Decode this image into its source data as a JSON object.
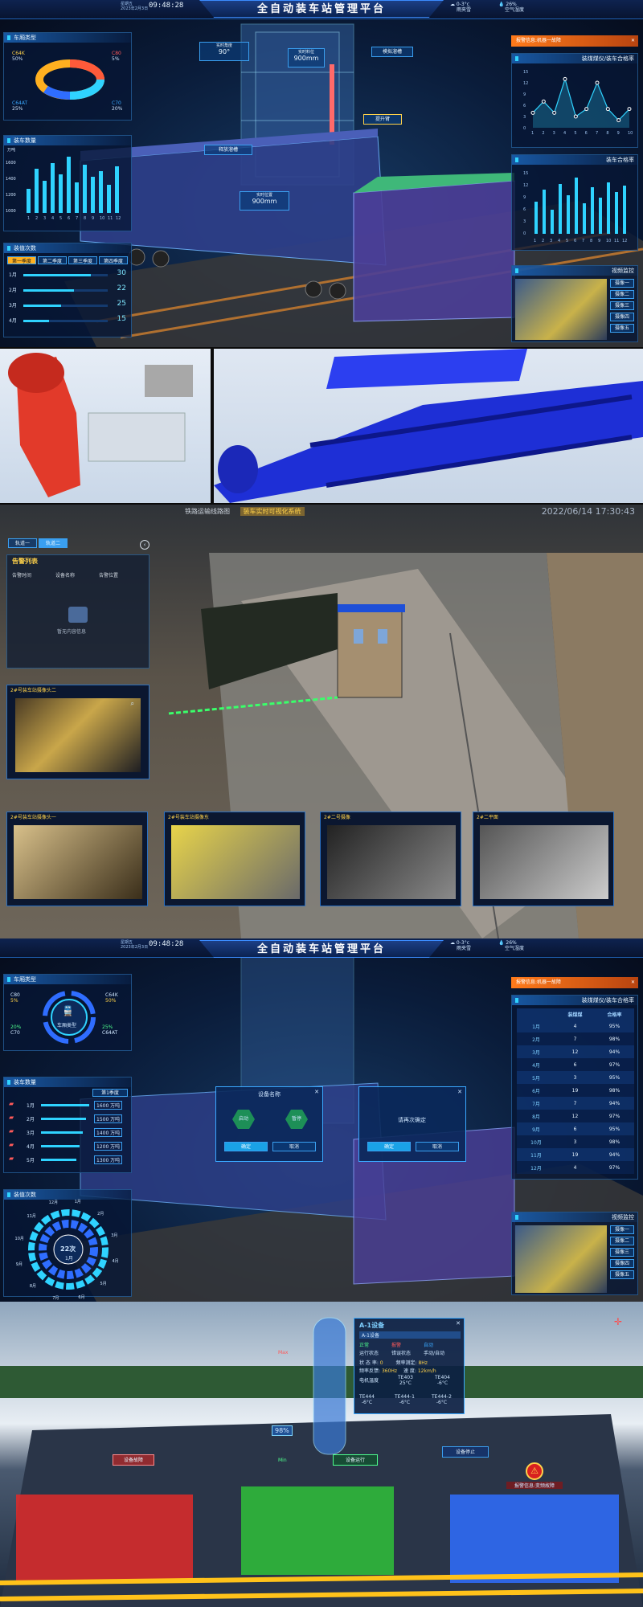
{
  "s1": {
    "title": "全自动装车站管理平台",
    "weekday": "星期五",
    "date": "2023年2月3日",
    "clock": "09:48:28",
    "weather": {
      "temp": "0-3°c",
      "label": "雨夹雪",
      "humidity": "26%",
      "hum_label": "空气湿度"
    },
    "car_types": {
      "title": "车厢类型",
      "items": [
        {
          "name": "C64K",
          "pct": "50%",
          "color": "#ffb020"
        },
        {
          "name": "C80",
          "pct": "5%",
          "color": "#ff5a3a"
        },
        {
          "name": "C64AT",
          "pct": "25%",
          "color": "#2fd3ff"
        },
        {
          "name": "C70",
          "pct": "20%",
          "color": "#2f6dff"
        }
      ]
    },
    "car_count": {
      "title": "装车数量",
      "unit": "万吨",
      "y_ticks": [
        "1600",
        "1400",
        "1200",
        "1000"
      ],
      "x_ticks": [
        "1",
        "2",
        "3",
        "4",
        "5",
        "6",
        "7",
        "8",
        "9",
        "10",
        "11",
        "12"
      ]
    },
    "rank": {
      "title": "装值次数",
      "tabs": [
        "第一季度",
        "第二季度",
        "第三季度",
        "第四季度"
      ],
      "rows": [
        {
          "label": "1月",
          "value": "30",
          "fill": 0.8
        },
        {
          "label": "2月",
          "value": "22",
          "fill": 0.6
        },
        {
          "label": "3月",
          "value": "25",
          "fill": 0.45
        },
        {
          "label": "4月",
          "value": "15",
          "fill": 0.3
        }
      ]
    },
    "tags": [
      {
        "label": "实时角度",
        "value": "90°"
      },
      {
        "label": "实时料位",
        "value": "900mm"
      },
      {
        "label": "实时位置",
        "value": "900mm"
      }
    ],
    "buttons": {
      "open_gate": "模拟溜槽",
      "lift": "提升臂",
      "release": "释放溜槽"
    },
    "alarm": {
      "label": "报警信息:",
      "value": "机器一故障"
    },
    "coal_rate": {
      "title": "装煤煤仪/装车合格率",
      "y_ticks": [
        "15",
        "12",
        "9",
        "6",
        "3",
        "0"
      ],
      "x_ticks": [
        "1",
        "2",
        "3",
        "4",
        "5",
        "6",
        "7",
        "8",
        "9",
        "10"
      ],
      "chart_data": {
        "type": "area",
        "x": [
          1,
          2,
          3,
          4,
          5,
          6,
          7,
          8,
          9,
          10
        ],
        "values": [
          4,
          7,
          4,
          13,
          3,
          5,
          12,
          5,
          2,
          5
        ],
        "ylim": [
          0,
          15
        ]
      }
    },
    "load_rate": {
      "title": "装车合格率",
      "y_ticks": [
        "15",
        "12",
        "9",
        "6",
        "3",
        "0"
      ],
      "x_ticks": [
        "1",
        "2",
        "3",
        "4",
        "5",
        "6",
        "7",
        "8",
        "9",
        "10",
        "11",
        "12"
      ]
    },
    "video": {
      "title": "视频监控",
      "cams": [
        "摄像一",
        "摄像二",
        "摄像三",
        "摄像四",
        "摄像五"
      ]
    }
  },
  "s3": {
    "nav": [
      "铁路运输线路图",
      "装车实时可视化系统"
    ],
    "datetime": "2022/06/14 17:30:43",
    "tracks": [
      "轨道一",
      "轨道二"
    ],
    "list": {
      "title": "告警列表",
      "cols": [
        "告警时间",
        "设备名称",
        "告警位置"
      ],
      "empty": "暂无内容信息"
    },
    "cams": [
      "2#号装车站摄像头二",
      "2#号装车站摄像头一",
      "2#号装车站摄像东",
      "2#二号摄像",
      "2#二平面"
    ]
  },
  "s4": {
    "title": "全自动装车站管理平台",
    "weekday": "星期五",
    "date": "2023年2月3日",
    "clock": "09:48:28",
    "weather": {
      "temp": "0-3°c",
      "label": "雨夹雪",
      "humidity": "26%",
      "hum_label": "空气湿度"
    },
    "car_types": {
      "title": "车厢类型",
      "center": "车厢类型",
      "items": [
        {
          "name": "C80",
          "pct": "5%"
        },
        {
          "name": "C64K",
          "pct": "50%"
        },
        {
          "name": "C70",
          "pct": "20%"
        },
        {
          "name": "C64AT",
          "pct": "25%"
        }
      ]
    },
    "car_count": {
      "title": "装车数量",
      "select": "第1季度",
      "rows": [
        {
          "label": "1月",
          "value": "1600 万吨"
        },
        {
          "label": "2月",
          "value": "1500 万吨"
        },
        {
          "label": "3月",
          "value": "1400 万吨"
        },
        {
          "label": "4月",
          "value": "1200 万吨"
        },
        {
          "label": "5月",
          "value": "1300 万吨"
        }
      ]
    },
    "rank": {
      "title": "装值次数",
      "center_value": "22次",
      "center_label": "1月",
      "months": [
        "12月",
        "11月",
        "10月",
        "9月",
        "8月",
        "7月",
        "6月",
        "5月",
        "4月",
        "3月",
        "2月",
        "1月"
      ]
    },
    "dialog1": {
      "title": "设备名称",
      "opt1": "启动",
      "opt2": "暂停",
      "ok": "确定",
      "cancel": "取消"
    },
    "dialog2": {
      "text": "请再次确定",
      "ok": "确定",
      "cancel": "取消"
    },
    "alarm": {
      "label": "报警信息:",
      "value": "机器一故障"
    },
    "table": {
      "title": "装煤煤仪/装车合格率",
      "cols": [
        "",
        "装煤煤",
        "合格率"
      ],
      "rows": [
        [
          "1月",
          "4",
          "95%"
        ],
        [
          "2月",
          "7",
          "98%"
        ],
        [
          "3月",
          "12",
          "94%"
        ],
        [
          "4月",
          "6",
          "97%"
        ],
        [
          "5月",
          "3",
          "95%"
        ],
        [
          "6月",
          "19",
          "98%"
        ],
        [
          "7月",
          "7",
          "94%"
        ],
        [
          "8月",
          "12",
          "97%"
        ],
        [
          "9月",
          "6",
          "95%"
        ],
        [
          "10月",
          "3",
          "98%"
        ],
        [
          "11月",
          "19",
          "94%"
        ],
        [
          "12月",
          "4",
          "97%"
        ]
      ]
    },
    "video": {
      "title": "视频监控",
      "cams": [
        "摄像一",
        "摄像二",
        "摄像三",
        "摄像四",
        "摄像五"
      ]
    }
  },
  "s5": {
    "device": {
      "title": "A-1设备",
      "sub": "A-1设备",
      "labels": [
        "运行状态",
        "错误状态",
        "手动/自动"
      ],
      "states": [
        "正常",
        "报警",
        "自动"
      ],
      "state_row": {
        "label1": "状 态 率:",
        "val1": "0",
        "label2": "频率测定:",
        "val2": "8Hz"
      },
      "freq_row": {
        "label1": "频率反馈:",
        "val1": "360Hz",
        "label2": "速   度:",
        "val2": "12km/h"
      },
      "motor": "电机温度",
      "temps": [
        {
          "name": "TE403",
          "val": "25°C"
        },
        {
          "name": "TE404",
          "val": "-6°C"
        },
        {
          "name": "TE444",
          "val": "-6°C"
        },
        {
          "name": "TE444-1",
          "val": "-6°C"
        },
        {
          "name": "TE444-2",
          "val": "-6°C"
        }
      ]
    },
    "level": {
      "max": "Max",
      "min": "Min",
      "value": "98%"
    },
    "tags": {
      "fault": "设备故障",
      "run": "设备运行",
      "stop": "设备停止",
      "warn": "报警信息:变频故障"
    }
  }
}
